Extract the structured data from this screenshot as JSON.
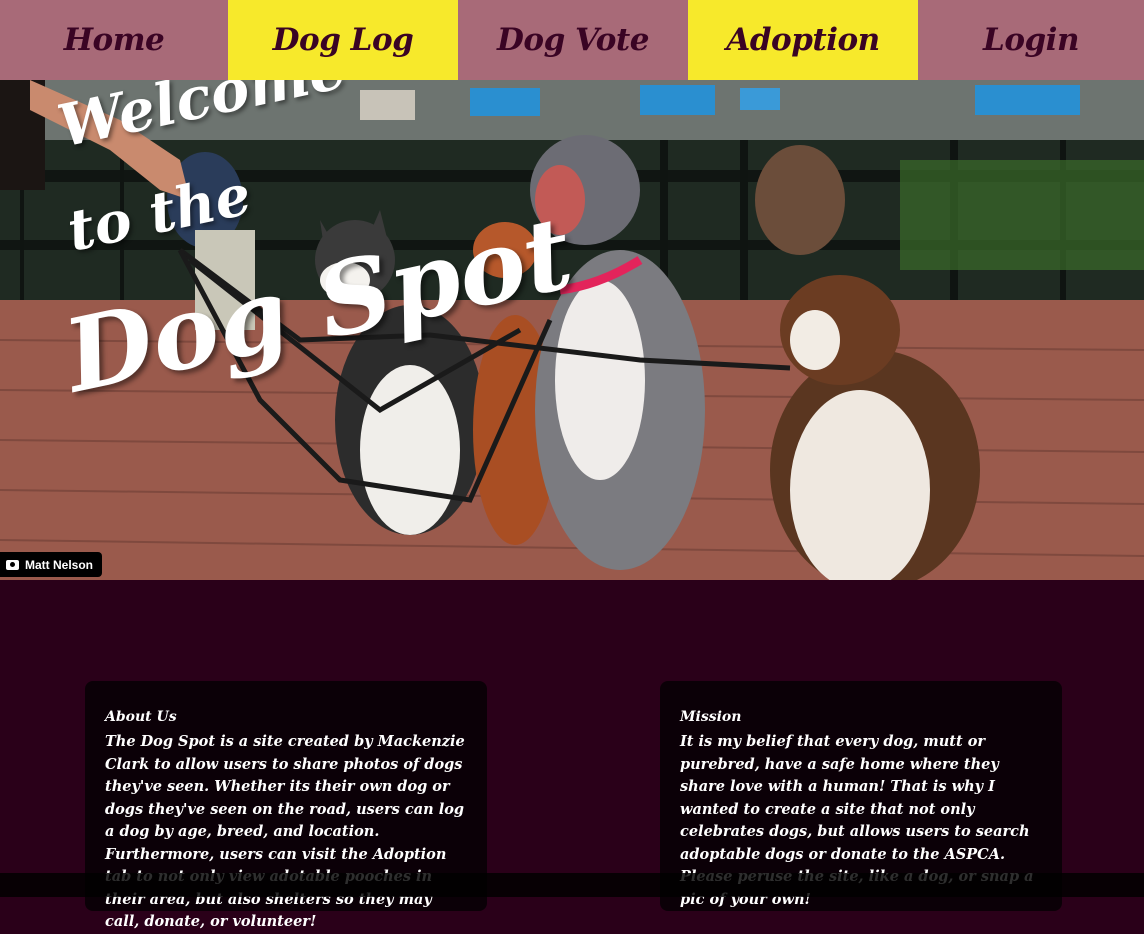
{
  "nav": {
    "items": [
      {
        "label": "Home"
      },
      {
        "label": "Dog Log"
      },
      {
        "label": "Dog Vote"
      },
      {
        "label": "Adoption"
      },
      {
        "label": "Login"
      }
    ]
  },
  "hero": {
    "line1": "Welcome",
    "line2": "to the",
    "line3": "Dog Spot",
    "photo_credit": "Matt Nelson"
  },
  "about": {
    "title": "About Us",
    "body": "The Dog Spot is a site created by Mackenzie Clark to allow users to share photos of dogs they've seen. Whether its their own dog or dogs they've seen on the road, users can log a dog by age, breed, and location. Furthermore, users can visit the Adoption tab to not only view adotable pooches in their area, but also shelters so they may call, donate, or volunteer!"
  },
  "mission": {
    "title": "Mission",
    "body": "It is my belief that every dog, mutt or purebred, have a safe home where they share love with a human! That is why I wanted to create a site that not only celebrates dogs, but allows users to search adoptable dogs or donate to the ASPCA. Please peruse the site, like a dog, or snap a pic of your own!"
  },
  "colors": {
    "nav_rose": "#a86a78",
    "nav_yellow": "#f7e92b",
    "nav_text": "#3a0424",
    "page_bg": "#2a0019",
    "card_bg": "#0b0007"
  }
}
